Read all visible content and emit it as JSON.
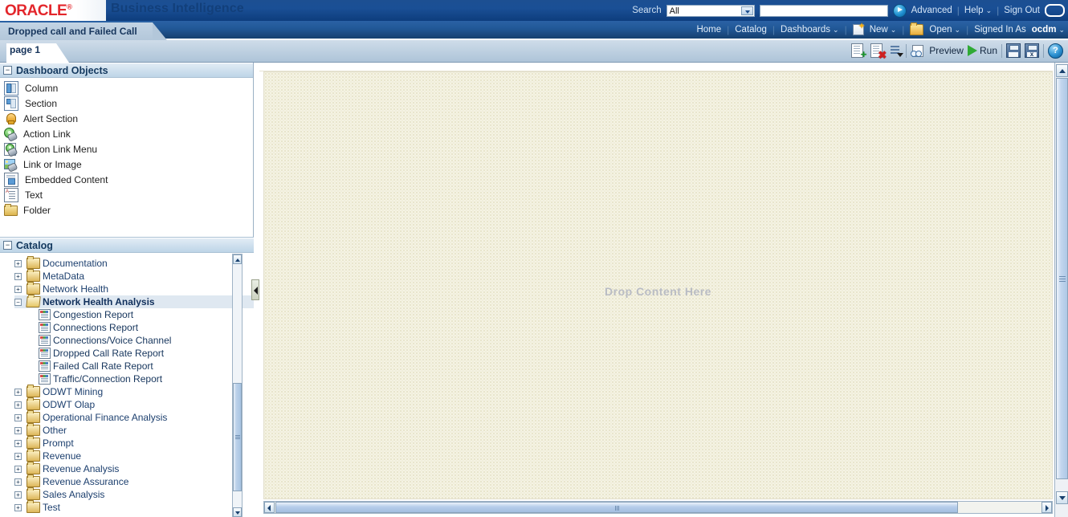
{
  "brand": {
    "logo": "ORACLE",
    "logo_reg": "®",
    "product": "Business Intelligence",
    "logo_color": "#e3262b",
    "title_color": "#123f7a"
  },
  "search": {
    "label": "Search",
    "scope_selected": "All",
    "scope_options": [
      "All"
    ],
    "query_value": "",
    "query_placeholder": "",
    "go_icon": "go-arrow-icon",
    "advanced_label": "Advanced",
    "help_label": "Help",
    "sign_out_label": "Sign Out"
  },
  "globalnav": {
    "home": "Home",
    "catalog": "Catalog",
    "dashboards": "Dashboards",
    "new": "New",
    "open": "Open",
    "signed_in_as_label": "Signed In As",
    "user": "ocdm"
  },
  "dashboard": {
    "title": "Dropped call and Failed Call",
    "page_tab": "page 1"
  },
  "edit_toolbar": {
    "add_page_icon": "add-page-icon",
    "delete_page_icon": "delete-page-icon",
    "tools_icon": "tools-menu-icon",
    "preview_label": "Preview",
    "run_label": "Run",
    "save_icon": "save-icon",
    "save_as_icon": "save-as-icon",
    "help_icon": "help-icon"
  },
  "objects_panel": {
    "title": "Dashboard Objects",
    "collapse_glyph": "−",
    "items": [
      {
        "label": "Column",
        "icon": "column-icon"
      },
      {
        "label": "Section",
        "icon": "section-icon"
      },
      {
        "label": "Alert Section",
        "icon": "alert-bell-icon"
      },
      {
        "label": "Action Link",
        "icon": "action-link-icon"
      },
      {
        "label": "Action Link Menu",
        "icon": "action-link-menu-icon"
      },
      {
        "label": "Link or Image",
        "icon": "link-or-image-icon"
      },
      {
        "label": "Embedded Content",
        "icon": "embedded-content-icon"
      },
      {
        "label": "Text",
        "icon": "text-icon"
      },
      {
        "label": "Folder",
        "icon": "folder-icon"
      }
    ]
  },
  "catalog_panel": {
    "title": "Catalog",
    "collapse_glyph": "−",
    "nodes": [
      {
        "label": "Documentation",
        "type": "folder",
        "state": "collapsed",
        "depth": 0
      },
      {
        "label": "MetaData",
        "type": "folder",
        "state": "collapsed",
        "depth": 0
      },
      {
        "label": "Network Health",
        "type": "folder",
        "state": "collapsed",
        "depth": 0
      },
      {
        "label": "Network Health Analysis",
        "type": "folder",
        "state": "expanded",
        "depth": 0,
        "selected": true
      },
      {
        "label": "Congestion Report",
        "type": "report",
        "depth": 1
      },
      {
        "label": "Connections Report",
        "type": "report",
        "depth": 1
      },
      {
        "label": "Connections/Voice Channel",
        "type": "report",
        "depth": 1
      },
      {
        "label": "Dropped Call Rate Report",
        "type": "report",
        "depth": 1
      },
      {
        "label": "Failed Call Rate Report",
        "type": "report",
        "depth": 1
      },
      {
        "label": "Traffic/Connection Report",
        "type": "report",
        "depth": 1
      },
      {
        "label": "ODWT Mining",
        "type": "folder",
        "state": "collapsed",
        "depth": 0
      },
      {
        "label": "ODWT Olap",
        "type": "folder",
        "state": "collapsed",
        "depth": 0
      },
      {
        "label": "Operational Finance Analysis",
        "type": "folder",
        "state": "collapsed",
        "depth": 0
      },
      {
        "label": "Other",
        "type": "folder",
        "state": "collapsed",
        "depth": 0
      },
      {
        "label": "Prompt",
        "type": "folder",
        "state": "collapsed",
        "depth": 0
      },
      {
        "label": "Revenue",
        "type": "folder",
        "state": "collapsed",
        "depth": 0
      },
      {
        "label": "Revenue Analysis",
        "type": "folder",
        "state": "collapsed",
        "depth": 0
      },
      {
        "label": "Revenue Assurance",
        "type": "folder",
        "state": "collapsed",
        "depth": 0
      },
      {
        "label": "Sales Analysis",
        "type": "folder",
        "state": "collapsed",
        "depth": 0
      },
      {
        "label": "Test",
        "type": "folder",
        "state": "collapsed",
        "depth": 0
      }
    ]
  },
  "canvas": {
    "drop_text": "Drop Content Here"
  },
  "expand_glyph": "+",
  "collapse_glyph": "−"
}
